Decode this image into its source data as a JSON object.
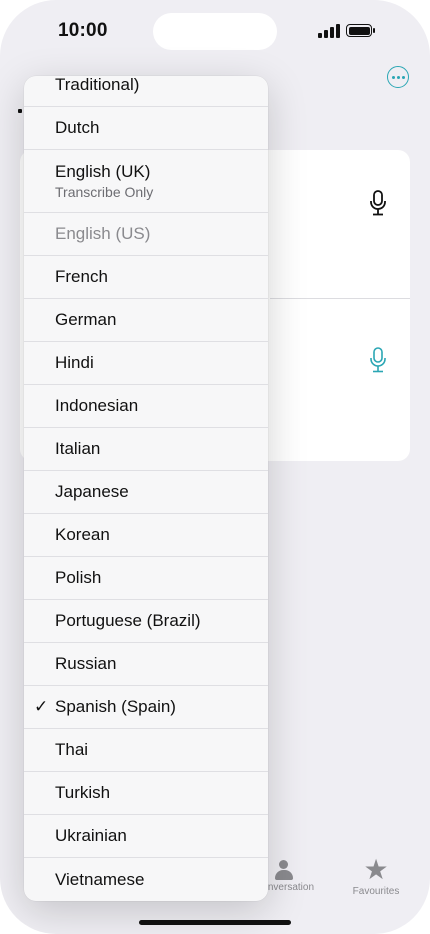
{
  "status_bar": {
    "time": "10:00"
  },
  "tab_bar": {
    "conversation_label": "Conversation",
    "favourites_label": "Favourites"
  },
  "language_menu": {
    "items": [
      {
        "label": "Traditional)",
        "sublabel": "",
        "checked": false,
        "disabled": false
      },
      {
        "label": "Dutch",
        "sublabel": "",
        "checked": false,
        "disabled": false
      },
      {
        "label": "English (UK)",
        "sublabel": "Transcribe Only",
        "checked": false,
        "disabled": false
      },
      {
        "label": "English (US)",
        "sublabel": "",
        "checked": false,
        "disabled": true
      },
      {
        "label": "French",
        "sublabel": "",
        "checked": false,
        "disabled": false
      },
      {
        "label": "German",
        "sublabel": "",
        "checked": false,
        "disabled": false
      },
      {
        "label": "Hindi",
        "sublabel": "",
        "checked": false,
        "disabled": false
      },
      {
        "label": "Indonesian",
        "sublabel": "",
        "checked": false,
        "disabled": false
      },
      {
        "label": "Italian",
        "sublabel": "",
        "checked": false,
        "disabled": false
      },
      {
        "label": "Japanese",
        "sublabel": "",
        "checked": false,
        "disabled": false
      },
      {
        "label": "Korean",
        "sublabel": "",
        "checked": false,
        "disabled": false
      },
      {
        "label": "Polish",
        "sublabel": "",
        "checked": false,
        "disabled": false
      },
      {
        "label": "Portuguese (Brazil)",
        "sublabel": "",
        "checked": false,
        "disabled": false
      },
      {
        "label": "Russian",
        "sublabel": "",
        "checked": false,
        "disabled": false
      },
      {
        "label": "Spanish (Spain)",
        "sublabel": "",
        "checked": true,
        "disabled": false
      },
      {
        "label": "Thai",
        "sublabel": "",
        "checked": false,
        "disabled": false
      },
      {
        "label": "Turkish",
        "sublabel": "",
        "checked": false,
        "disabled": false
      },
      {
        "label": "Ukrainian",
        "sublabel": "",
        "checked": false,
        "disabled": false
      },
      {
        "label": "Vietnamese",
        "sublabel": "",
        "checked": false,
        "disabled": false
      }
    ],
    "check_glyph": "✓"
  },
  "colors": {
    "accent": "#2aa6b4",
    "background": "#efeef3",
    "menu_background": "#f7f7f8"
  },
  "icons": [
    "signal-icon",
    "battery-icon",
    "more-icon",
    "microphone-icon",
    "person-icon",
    "star-icon",
    "checkmark-icon"
  ]
}
